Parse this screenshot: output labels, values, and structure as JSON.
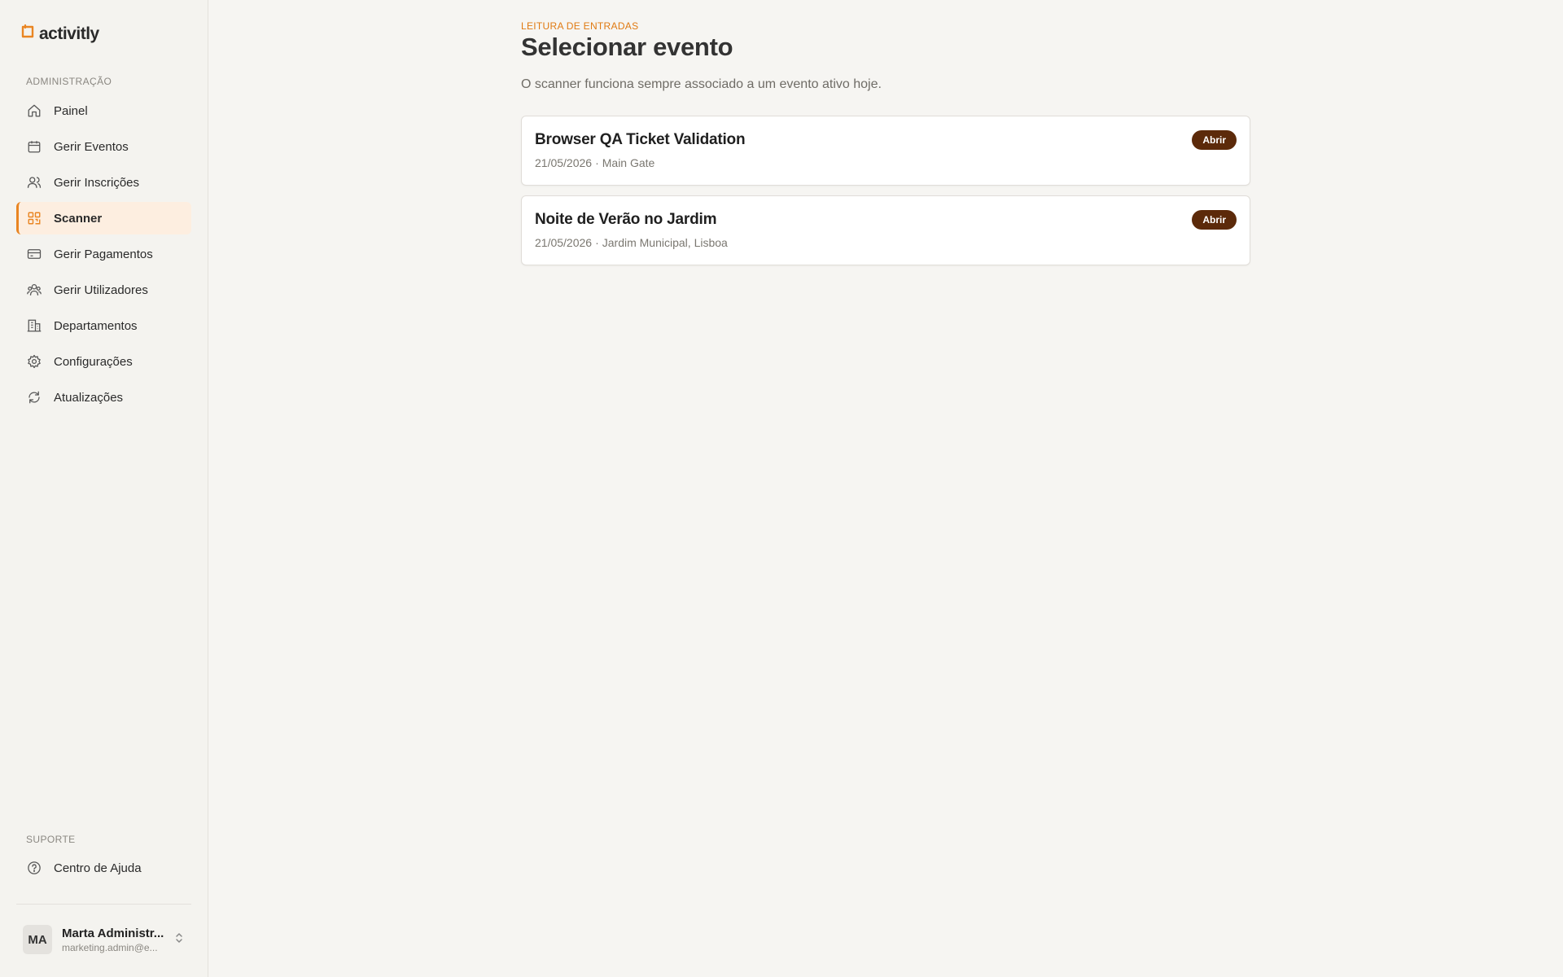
{
  "brand": {
    "name": "activitly",
    "accent_color": "#e98522"
  },
  "sidebar": {
    "admin_section_label": "ADMINISTRAÇÃO",
    "items": [
      {
        "label": "Painel",
        "icon": "home-icon"
      },
      {
        "label": "Gerir Eventos",
        "icon": "calendar-icon"
      },
      {
        "label": "Gerir Inscrições",
        "icon": "users-icon"
      },
      {
        "label": "Scanner",
        "icon": "qr-scan-icon",
        "active": true
      },
      {
        "label": "Gerir Pagamentos",
        "icon": "credit-card-icon"
      },
      {
        "label": "Gerir Utilizadores",
        "icon": "user-group-icon"
      },
      {
        "label": "Departamentos",
        "icon": "building-icon"
      },
      {
        "label": "Configurações",
        "icon": "gear-icon"
      },
      {
        "label": "Atualizações",
        "icon": "refresh-icon"
      }
    ],
    "support_section_label": "SUPORTE",
    "support_items": [
      {
        "label": "Centro de Ajuda",
        "icon": "help-circle-icon"
      }
    ],
    "user": {
      "initials": "MA",
      "name": "Marta Administr...",
      "email": "marketing.admin@e..."
    }
  },
  "main": {
    "eyebrow": "LEITURA DE ENTRADAS",
    "title": "Selecionar evento",
    "subtitle": "O scanner funciona sempre associado a um evento ativo hoje.",
    "events": [
      {
        "title": "Browser QA Ticket Validation",
        "date": "21/05/2026",
        "separator": "·",
        "location": "Main Gate",
        "action_label": "Abrir"
      },
      {
        "title": "Noite de Verão no Jardim",
        "date": "21/05/2026",
        "separator": "·",
        "location": "Jardim Municipal, Lisboa",
        "action_label": "Abrir"
      }
    ]
  }
}
